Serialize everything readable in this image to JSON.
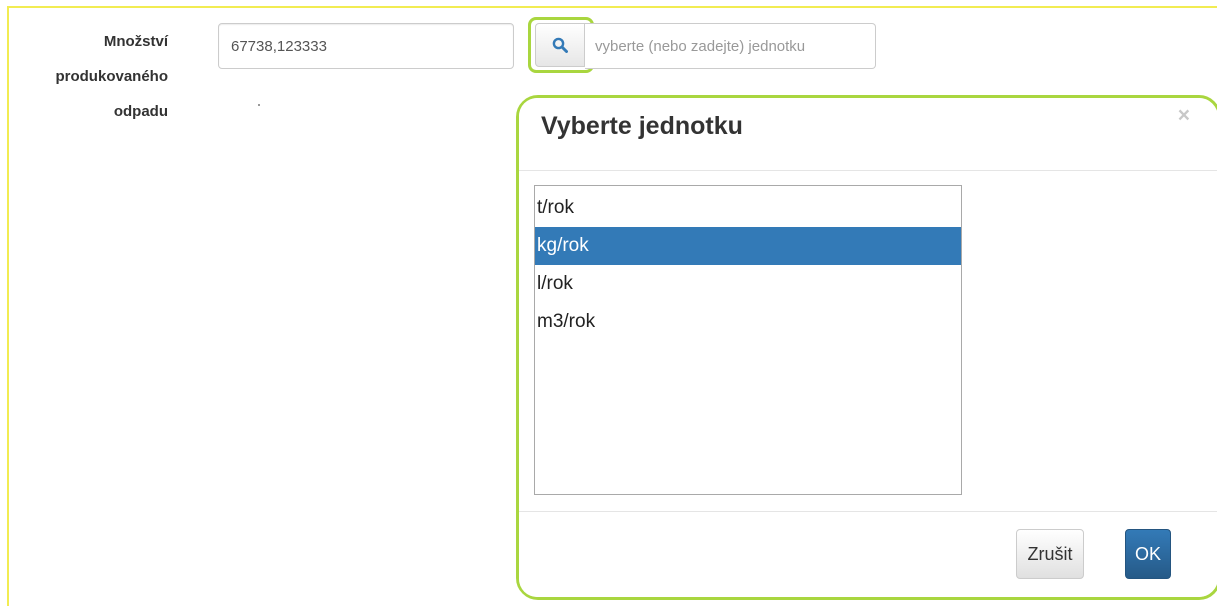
{
  "form": {
    "label_lines": [
      "Množství",
      "produkovaného",
      "odpadu"
    ],
    "amount_value": "67738,123333",
    "unit_placeholder": "vyberte (nebo zadejte) jednotku"
  },
  "modal": {
    "title": "Vyberte jednotku",
    "close_symbol": "×",
    "options": [
      "t/rok",
      "kg/rok",
      "l/rok",
      "m3/rok"
    ],
    "selected": "kg/rok",
    "cancel_label": "Zrušit",
    "ok_label": "OK"
  },
  "icons": {
    "search": "search-icon",
    "close": "close-icon"
  },
  "colors": {
    "highlight": "#a9d63f",
    "frame": "#f2ec52",
    "selected_bg": "#337ab7",
    "primary": "#337ab7",
    "search_icon": "#337ab7"
  }
}
